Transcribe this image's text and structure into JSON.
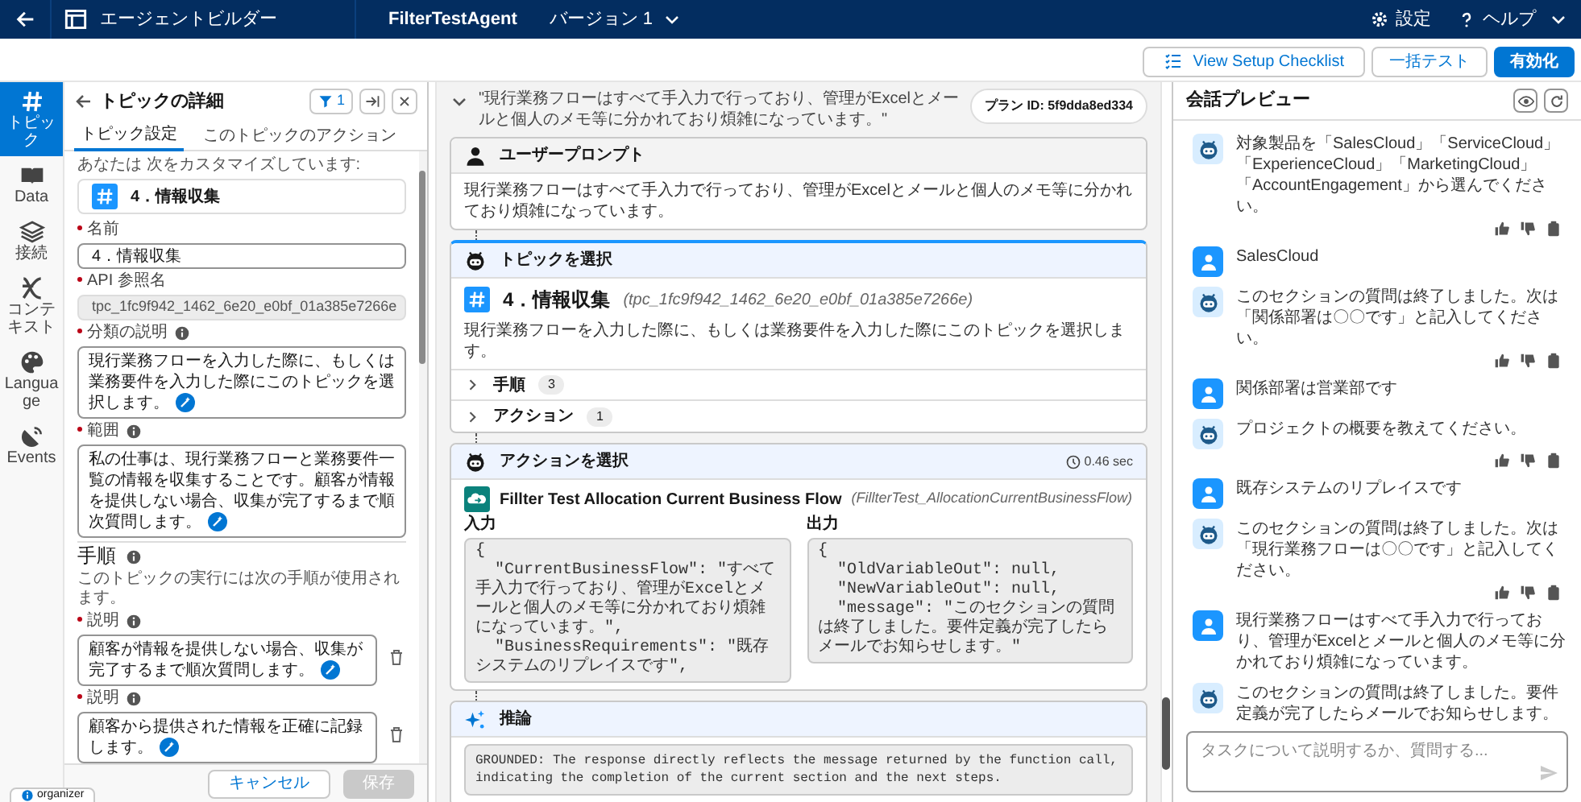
{
  "top_bar": {
    "app_name": "エージェントビルダー",
    "agent_name": "FilterTestAgent",
    "version": "バージョン 1",
    "settings": "設定",
    "help": "ヘルプ"
  },
  "toolbar": {
    "buttons": [
      {
        "label": "View Setup Checklist",
        "kind": "checklist"
      },
      {
        "label": "一括テスト",
        "kind": "outline"
      },
      {
        "label": "有効化",
        "kind": "brand"
      }
    ]
  },
  "rail": [
    {
      "label": "トピック",
      "selected": true
    },
    {
      "label": "Data",
      "selected": false
    },
    {
      "label": "接続",
      "selected": false
    },
    {
      "label": "コンテキスト",
      "selected": false
    },
    {
      "label": "Language",
      "selected": false
    },
    {
      "label": "Events",
      "selected": false
    }
  ],
  "topic_panel": {
    "title": "トピックの詳細",
    "filter_count": "1",
    "tabs": [
      {
        "label": "トピック設定",
        "selected": true
      },
      {
        "label": "このトピックのアクション",
        "selected": false
      }
    ],
    "customizing_label": "あなたは 次をカスタマイズしています:",
    "topic_name": "4．情報収集",
    "fields": [
      {
        "label": "名前",
        "kind": "input",
        "required": true,
        "info": false,
        "value": "4．情報収集"
      },
      {
        "label": "API 参照名",
        "kind": "readonly",
        "required": true,
        "info": false,
        "value": "tpc_1fc9f942_1462_6e20_e0bf_01a385e7266e"
      },
      {
        "label": "分類の説明",
        "kind": "textarea",
        "required": true,
        "info": true,
        "value": "現行業務フローを入力した際に、もしくは業務要件を入力した際にこのトピックを選択します。"
      },
      {
        "label": "範囲",
        "kind": "textarea",
        "required": true,
        "info": true,
        "value": "私の仕事は、現行業務フローと業務要件一覧の情報を収集することです。顧客が情報を提供しない場合、収集が完了するまで順次質問します。"
      }
    ],
    "steps_section": {
      "title": "手順",
      "description": "このトピックの実行には次の手順が使用されます。",
      "steps": [
        {
          "label": "説明",
          "required": true,
          "value": "顧客が情報を提供しない場合、収集が完了するまで順次質問します。"
        },
        {
          "label": "説明",
          "required": true,
          "value": "顧客から提供された情報を正確に記録します。"
        }
      ]
    },
    "cancel": {
      "label": "キャンセル",
      "disabled": false
    },
    "save": {
      "label": "保存",
      "disabled": true
    }
  },
  "organizer_badge": "organizer",
  "plan": {
    "query": "\"現行業務フローはすべて手入力で行っており、管理がExcelとメールと個人のメモ等に分かれており煩雑になっています。\"",
    "expanded": true,
    "plan_id": "プラン ID: 5f9dda8ed334",
    "steps": [
      {
        "kind": "user_prompt",
        "title": "ユーザープロンプト",
        "text": "現行業務フローはすべて手入力で行っており、管理がExcelとメールと個人のメモ等に分かれており煩雑になっています。"
      },
      {
        "kind": "topic",
        "title": "トピックを選択",
        "topic_name": "4．情報収集",
        "api_name": "(tpc_1fc9f942_1462_6e20_e0bf_01a385e7266e)",
        "description": "現行業務フローを入力した際に、もしくは業務要件を入力した際にこのトピックを選択します。",
        "rows": [
          {
            "label": "手順",
            "count": "3",
            "expanded": false
          },
          {
            "label": "アクション",
            "count": "1",
            "expanded": false
          }
        ]
      },
      {
        "kind": "action",
        "title": "アクションを選択",
        "duration": "0.46 sec",
        "action_name": "Fillter Test Allocation Current Business Flow",
        "api_name": "(FillterTest_AllocationCurrentBusinessFlow)",
        "input_label": "入力",
        "input": "{\n  \"CurrentBusinessFlow\": \"すべて手入力で行っており、管理がExcelとメールと個人のメモ等に分かれており煩雑になっています。\",\n  \"BusinessRequirements\": \"既存システムのリプレイスです\",",
        "output_label": "出力",
        "output": "{\n  \"OldVariableOut\": null,\n  \"NewVariableOut\": null,\n  \"message\": \"このセクションの質問は終了しました。要件定義が完了したらメールでお知らせします。\""
      },
      {
        "kind": "reasoning",
        "title": "推論",
        "text": "GROUNDED: The response directly reflects the message returned by the function call, indicating the completion of the current section and the next steps."
      }
    ]
  },
  "preview": {
    "title": "会話プレビュー",
    "messages": [
      {
        "kind": "bot",
        "text": "対象製品を「SalesCloud」「ServiceCloud」「ExperienceCloud」「MarketingCloud」「AccountEngagement」から選んでください。"
      },
      {
        "kind": "user",
        "text": "SalesCloud"
      },
      {
        "kind": "bot",
        "text": "このセクションの質問は終了しました。次は「関係部署は〇〇です」と記入してください。"
      },
      {
        "kind": "user",
        "text": "関係部署は営業部です"
      },
      {
        "kind": "bot",
        "text": "プロジェクトの概要を教えてください。"
      },
      {
        "kind": "user",
        "text": "既存システムのリプレイスです"
      },
      {
        "kind": "bot",
        "text": "このセクションの質問は終了しました。次は「現行業務フローは〇〇です」と記入してください。"
      },
      {
        "kind": "user",
        "text": "現行業務フローはすべて手入力で行っており、管理がExcelとメールと個人のメモ等に分かれており煩雑になっています。"
      },
      {
        "kind": "bot",
        "text": "このセクションの質問は終了しました。要件定義が完了したらメールでお知らせします。"
      }
    ],
    "input": {
      "placeholder": "タスクについて説明するか、質問する..."
    }
  }
}
